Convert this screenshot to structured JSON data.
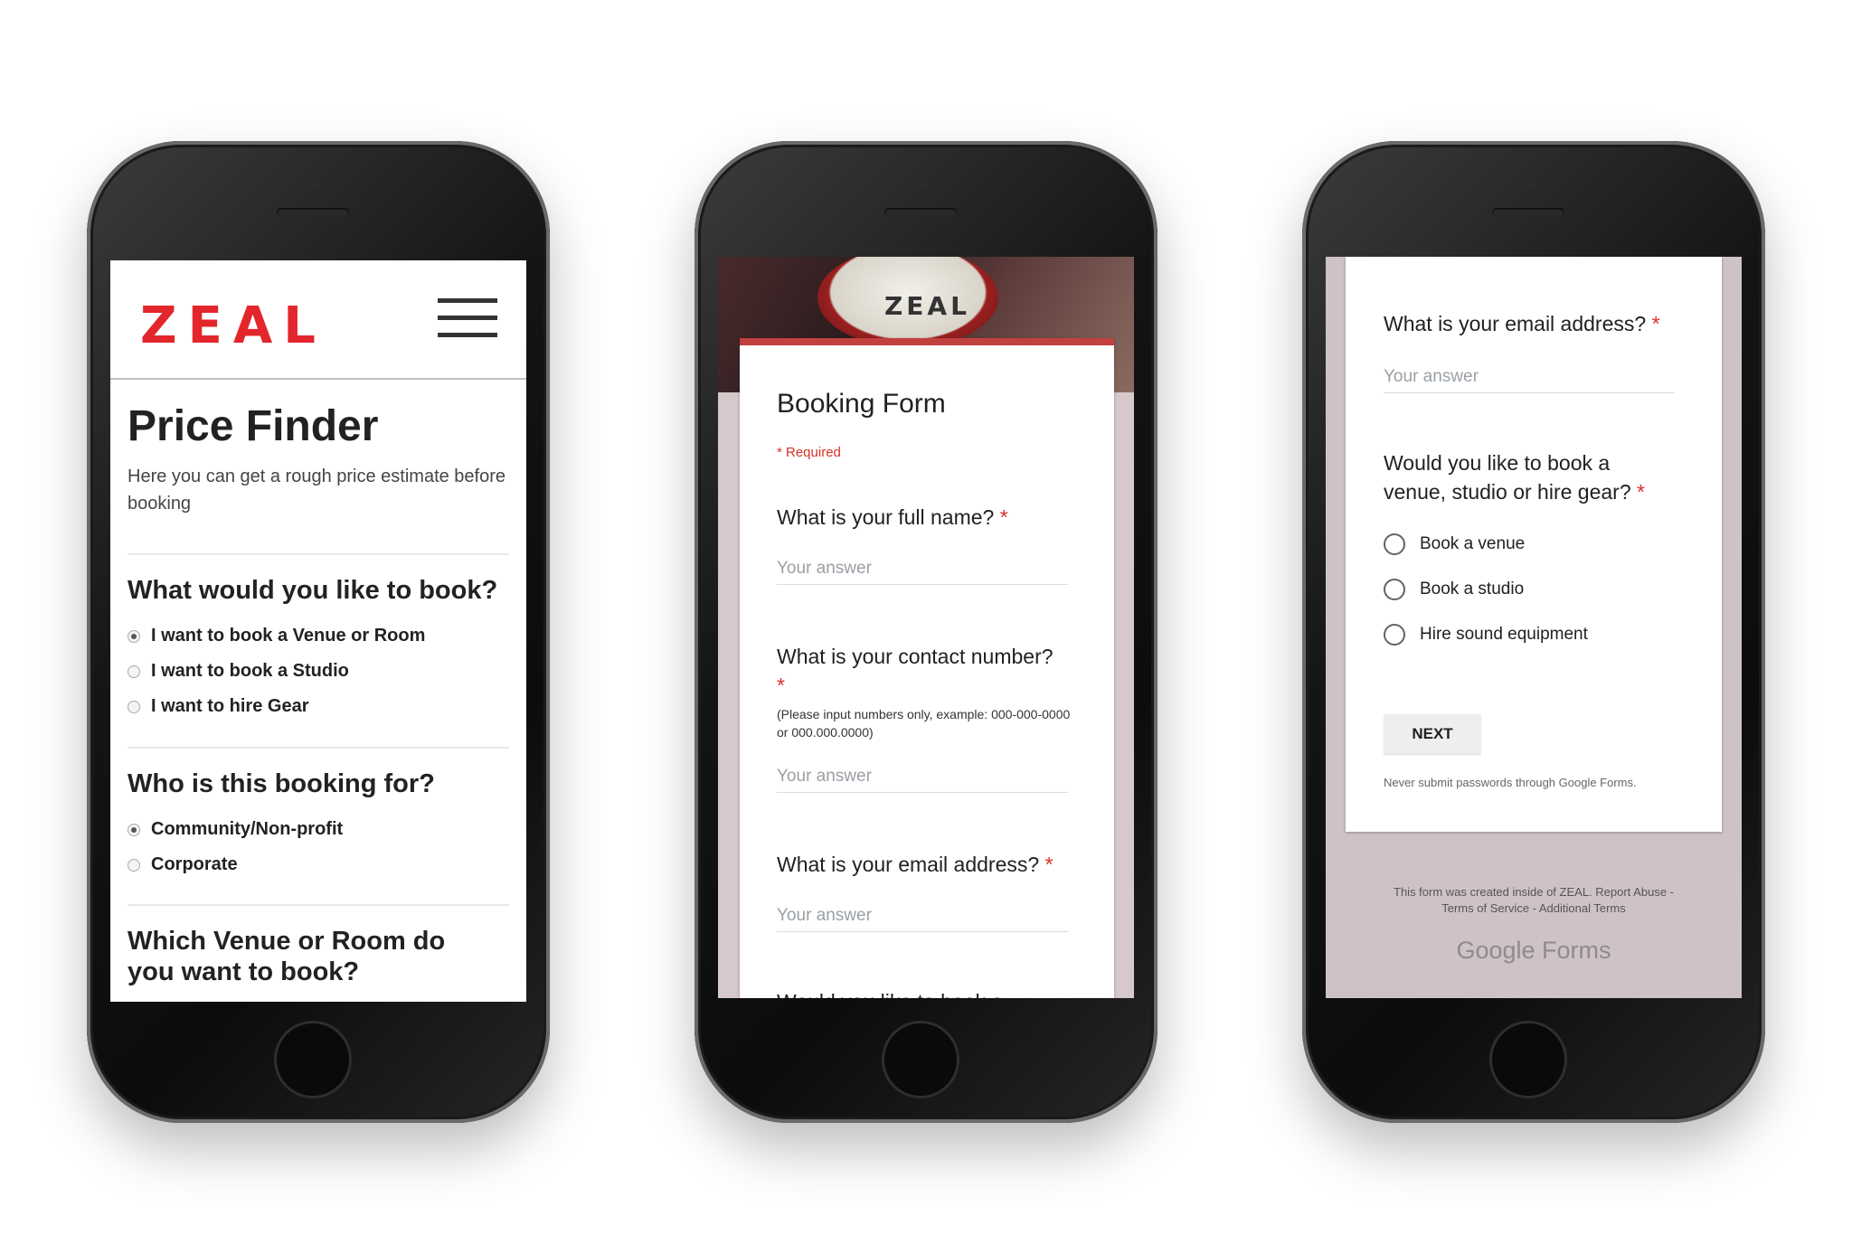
{
  "phone1": {
    "logo": "ZEAL",
    "title": "Price Finder",
    "subtitle": "Here you can get a rough price estimate before booking",
    "q1": "What would you like to book?",
    "q1_options": [
      "I want to book a Venue or Room",
      "I want to book a Studio",
      "I want to hire Gear"
    ],
    "q2": "Who is this booking for?",
    "q2_options": [
      "Community/Non-profit",
      "Corporate"
    ],
    "q3": "Which Venue or Room do you want to book?"
  },
  "phone2": {
    "hero_text": "ZEAL",
    "form_title": "Booking Form",
    "required_note": "* Required",
    "q_name": "What is your full name?",
    "q_contact": "What is your contact number?",
    "contact_hint": "(Please input numbers only, example: 000-000-0000 or 000.000.0000)",
    "q_email": "What is your email address?",
    "q_partial": "Would you like to book a",
    "answer_placeholder": "Your answer",
    "star": "*"
  },
  "phone3": {
    "q_email": "What is your email address?",
    "answer_placeholder": "Your answer",
    "q_book": "Would you like to book a venue, studio or hire gear?",
    "options": [
      "Book a venue",
      "Book a studio",
      "Hire sound equipment"
    ],
    "next": "NEXT",
    "never_submit": "Never submit passwords through Google Forms.",
    "footer_line1": "This form was created inside of ZEAL. Report Abuse -",
    "footer_line2": "Terms of Service - Additional Terms",
    "google_forms": "Google Forms",
    "star": "*"
  },
  "colors": {
    "brand_red": "#e3262c",
    "required_red": "#d93025",
    "form_bg": "#d6c8cb"
  }
}
